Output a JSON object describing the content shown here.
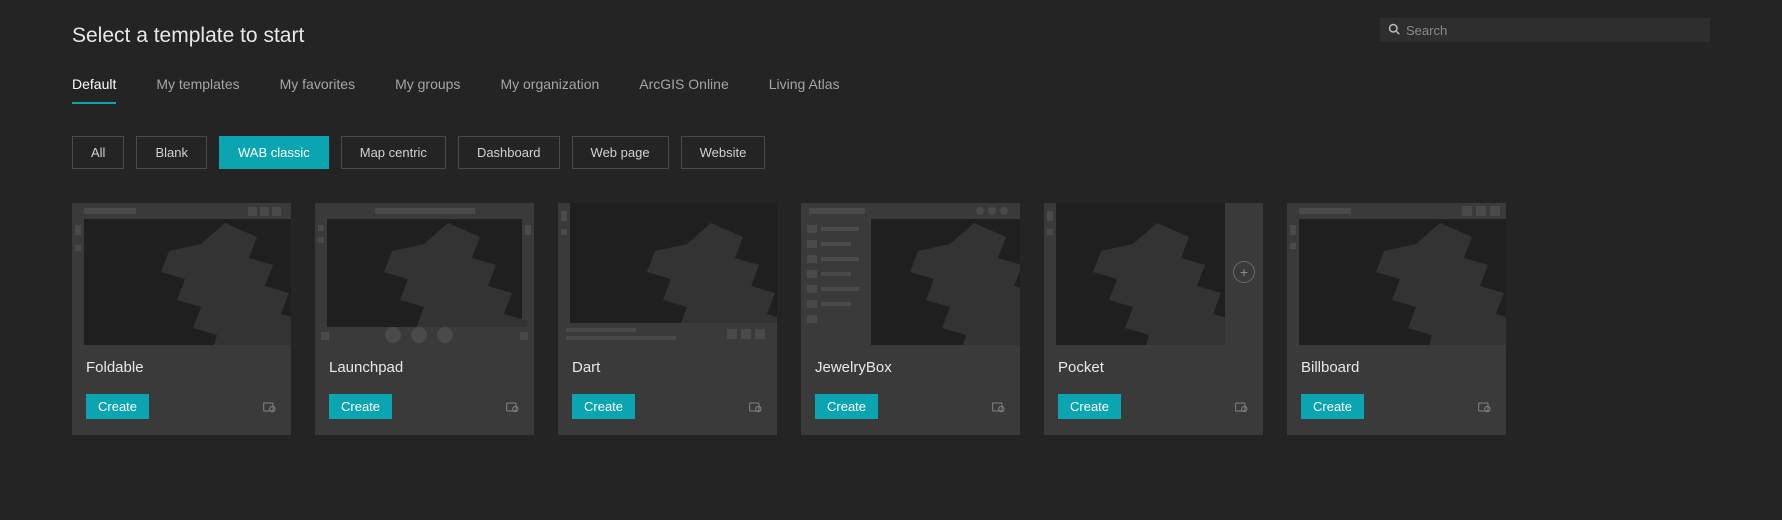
{
  "title": "Select a template to start",
  "search": {
    "placeholder": "Search"
  },
  "tabs": [
    {
      "label": "Default",
      "active": true
    },
    {
      "label": "My templates",
      "active": false
    },
    {
      "label": "My favorites",
      "active": false
    },
    {
      "label": "My groups",
      "active": false
    },
    {
      "label": "My organization",
      "active": false
    },
    {
      "label": "ArcGIS Online",
      "active": false
    },
    {
      "label": "Living Atlas",
      "active": false
    }
  ],
  "filters": [
    {
      "label": "All",
      "active": false
    },
    {
      "label": "Blank",
      "active": false
    },
    {
      "label": "WAB classic",
      "active": true
    },
    {
      "label": "Map centric",
      "active": false
    },
    {
      "label": "Dashboard",
      "active": false
    },
    {
      "label": "Web page",
      "active": false
    },
    {
      "label": "Website",
      "active": false
    }
  ],
  "create_label": "Create",
  "templates": [
    {
      "name": "Foldable"
    },
    {
      "name": "Launchpad"
    },
    {
      "name": "Dart"
    },
    {
      "name": "JewelryBox"
    },
    {
      "name": "Pocket"
    },
    {
      "name": "Billboard"
    }
  ]
}
